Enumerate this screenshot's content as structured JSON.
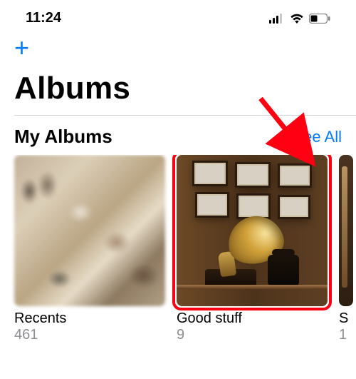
{
  "status_bar": {
    "time": "11:24"
  },
  "toolbar": {
    "add_label": "+"
  },
  "page_title": "Albums",
  "section": {
    "title": "My Albums",
    "see_all_label": "See All"
  },
  "albums": [
    {
      "name": "Recents",
      "count": "461"
    },
    {
      "name": "Good stuff",
      "count": "9"
    },
    {
      "name": "S",
      "count": "1"
    }
  ],
  "colors": {
    "accent": "#007aff",
    "highlight": "#ff0012"
  }
}
